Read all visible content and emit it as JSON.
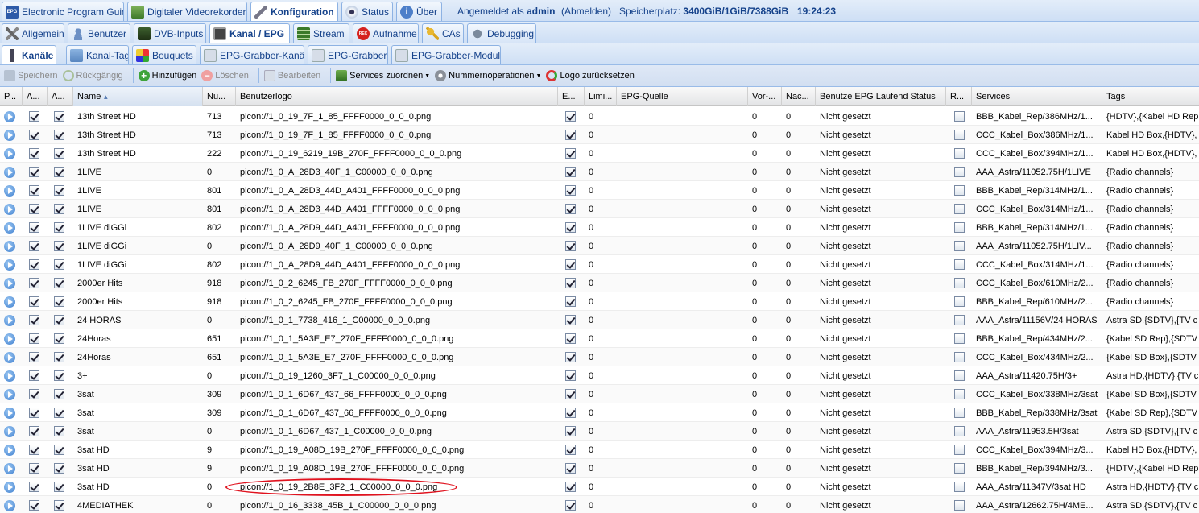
{
  "top_tabs": [
    {
      "label": "Electronic Program Guide",
      "icon": "epg-icon"
    },
    {
      "label": "Digitaler Videorekorder",
      "icon": "dvr-icon"
    },
    {
      "label": "Konfiguration",
      "icon": "wrench-icon",
      "active": true
    },
    {
      "label": "Status",
      "icon": "eye-icon"
    },
    {
      "label": "Über",
      "icon": "info-icon"
    }
  ],
  "status": {
    "logged_in_prefix": "Angemeldet als",
    "user": "admin",
    "logout": "(Abmelden)",
    "storage_prefix": "Speicherplatz:",
    "storage": "3400GiB/1GiB/7388GiB",
    "time": "19:24:23"
  },
  "config_tabs": [
    {
      "label": "Allgemein",
      "icon": "tools-icon"
    },
    {
      "label": "Benutzer",
      "icon": "user-icon"
    },
    {
      "label": "DVB-Inputs",
      "icon": "dvb-icon"
    },
    {
      "label": "Kanal / EPG",
      "icon": "tv-icon",
      "active": true
    },
    {
      "label": "Stream",
      "icon": "stream-icon"
    },
    {
      "label": "Aufnahme",
      "icon": "rec-icon"
    },
    {
      "label": "CAs",
      "icon": "key-icon"
    },
    {
      "label": "Debugging",
      "icon": "bug-icon"
    }
  ],
  "channel_tabs": [
    {
      "label": "Kanäle",
      "icon": "channel-icon",
      "active": true
    },
    {
      "label": "Kanal-Tags",
      "icon": "tag-icon"
    },
    {
      "label": "Bouquets",
      "icon": "bouquet-icon"
    },
    {
      "label": "EPG-Grabber-Kanäle",
      "icon": "grabber-channel-icon"
    },
    {
      "label": "EPG-Grabber",
      "icon": "grabber-icon"
    },
    {
      "label": "EPG-Grabber-Module",
      "icon": "grabber-module-icon"
    }
  ],
  "toolbar": {
    "save": "Speichern",
    "undo": "Rückgängig",
    "add": "Hinzufügen",
    "delete": "Löschen",
    "edit": "Bearbeiten",
    "services": "Services zuordnen",
    "numbering": "Nummernoperationen",
    "reset_logo": "Logo zurücksetzen"
  },
  "columns": [
    "P...",
    "A...",
    "A...",
    "Name",
    "Nu...",
    "Benutzerlogo",
    "E...",
    "Limi...",
    "EPG-Quelle",
    "Vor-...",
    "Nac...",
    "Benutze EPG Laufend Status",
    "R...",
    "Services",
    "Tags"
  ],
  "rows": [
    {
      "name": "13th Street HD",
      "num": "713",
      "logo": "picon://1_0_19_7F_1_85_FFFF0000_0_0_0.png",
      "limit": "0",
      "pre": "0",
      "post": "0",
      "status": "Nicht gesetzt",
      "services": "BBB_Kabel_Rep/386MHz/1...",
      "tags": "{HDTV},{Kabel HD Rep"
    },
    {
      "name": "13th Street HD",
      "num": "713",
      "logo": "picon://1_0_19_7F_1_85_FFFF0000_0_0_0.png",
      "limit": "0",
      "pre": "0",
      "post": "0",
      "status": "Nicht gesetzt",
      "services": "CCC_Kabel_Box/386MHz/1...",
      "tags": "Kabel HD Box,{HDTV},"
    },
    {
      "name": "13th Street HD",
      "num": "222",
      "logo": "picon://1_0_19_6219_19B_270F_FFFF0000_0_0_0.png",
      "limit": "0",
      "pre": "0",
      "post": "0",
      "status": "Nicht gesetzt",
      "services": "CCC_Kabel_Box/394MHz/1...",
      "tags": "Kabel HD Box,{HDTV},"
    },
    {
      "name": "1LIVE",
      "num": "0",
      "logo": "picon://1_0_A_28D3_40F_1_C00000_0_0_0.png",
      "limit": "0",
      "pre": "0",
      "post": "0",
      "status": "Nicht gesetzt",
      "services": "AAA_Astra/11052.75H/1LIVE",
      "tags": "{Radio channels}"
    },
    {
      "name": "1LIVE",
      "num": "801",
      "logo": "picon://1_0_A_28D3_44D_A401_FFFF0000_0_0_0.png",
      "limit": "0",
      "pre": "0",
      "post": "0",
      "status": "Nicht gesetzt",
      "services": "BBB_Kabel_Rep/314MHz/1...",
      "tags": "{Radio channels}"
    },
    {
      "name": "1LIVE",
      "num": "801",
      "logo": "picon://1_0_A_28D3_44D_A401_FFFF0000_0_0_0.png",
      "limit": "0",
      "pre": "0",
      "post": "0",
      "status": "Nicht gesetzt",
      "services": "CCC_Kabel_Box/314MHz/1...",
      "tags": "{Radio channels}"
    },
    {
      "name": "1LIVE diGGi",
      "num": "802",
      "logo": "picon://1_0_A_28D9_44D_A401_FFFF0000_0_0_0.png",
      "limit": "0",
      "pre": "0",
      "post": "0",
      "status": "Nicht gesetzt",
      "services": "BBB_Kabel_Rep/314MHz/1...",
      "tags": "{Radio channels}"
    },
    {
      "name": "1LIVE diGGi",
      "num": "0",
      "logo": "picon://1_0_A_28D9_40F_1_C00000_0_0_0.png",
      "limit": "0",
      "pre": "0",
      "post": "0",
      "status": "Nicht gesetzt",
      "services": "AAA_Astra/11052.75H/1LIV...",
      "tags": "{Radio channels}"
    },
    {
      "name": "1LIVE diGGi",
      "num": "802",
      "logo": "picon://1_0_A_28D9_44D_A401_FFFF0000_0_0_0.png",
      "limit": "0",
      "pre": "0",
      "post": "0",
      "status": "Nicht gesetzt",
      "services": "CCC_Kabel_Box/314MHz/1...",
      "tags": "{Radio channels}"
    },
    {
      "name": "2000er Hits",
      "num": "918",
      "logo": "picon://1_0_2_6245_FB_270F_FFFF0000_0_0_0.png",
      "limit": "0",
      "pre": "0",
      "post": "0",
      "status": "Nicht gesetzt",
      "services": "CCC_Kabel_Box/610MHz/2...",
      "tags": "{Radio channels}"
    },
    {
      "name": "2000er Hits",
      "num": "918",
      "logo": "picon://1_0_2_6245_FB_270F_FFFF0000_0_0_0.png",
      "limit": "0",
      "pre": "0",
      "post": "0",
      "status": "Nicht gesetzt",
      "services": "BBB_Kabel_Rep/610MHz/2...",
      "tags": "{Radio channels}"
    },
    {
      "name": "24 HORAS",
      "num": "0",
      "logo": "picon://1_0_1_7738_416_1_C00000_0_0_0.png",
      "limit": "0",
      "pre": "0",
      "post": "0",
      "status": "Nicht gesetzt",
      "services": "AAA_Astra/11156V/24 HORAS",
      "tags": "Astra SD,{SDTV},{TV c"
    },
    {
      "name": "24Horas",
      "num": "651",
      "logo": "picon://1_0_1_5A3E_E7_270F_FFFF0000_0_0_0.png",
      "limit": "0",
      "pre": "0",
      "post": "0",
      "status": "Nicht gesetzt",
      "services": "BBB_Kabel_Rep/434MHz/2...",
      "tags": "{Kabel SD Rep},{SDTV"
    },
    {
      "name": "24Horas",
      "num": "651",
      "logo": "picon://1_0_1_5A3E_E7_270F_FFFF0000_0_0_0.png",
      "limit": "0",
      "pre": "0",
      "post": "0",
      "status": "Nicht gesetzt",
      "services": "CCC_Kabel_Box/434MHz/2...",
      "tags": "{Kabel SD Box},{SDTV"
    },
    {
      "name": "3+",
      "num": "0",
      "logo": "picon://1_0_19_1260_3F7_1_C00000_0_0_0.png",
      "limit": "0",
      "pre": "0",
      "post": "0",
      "status": "Nicht gesetzt",
      "services": "AAA_Astra/11420.75H/3+",
      "tags": "Astra HD,{HDTV},{TV c"
    },
    {
      "name": "3sat",
      "num": "309",
      "logo": "picon://1_0_1_6D67_437_66_FFFF0000_0_0_0.png",
      "limit": "0",
      "pre": "0",
      "post": "0",
      "status": "Nicht gesetzt",
      "services": "CCC_Kabel_Box/338MHz/3sat",
      "tags": "{Kabel SD Box},{SDTV"
    },
    {
      "name": "3sat",
      "num": "309",
      "logo": "picon://1_0_1_6D67_437_66_FFFF0000_0_0_0.png",
      "limit": "0",
      "pre": "0",
      "post": "0",
      "status": "Nicht gesetzt",
      "services": "BBB_Kabel_Rep/338MHz/3sat",
      "tags": "{Kabel SD Rep},{SDTV"
    },
    {
      "name": "3sat",
      "num": "0",
      "logo": "picon://1_0_1_6D67_437_1_C00000_0_0_0.png",
      "limit": "0",
      "pre": "0",
      "post": "0",
      "status": "Nicht gesetzt",
      "services": "AAA_Astra/11953.5H/3sat",
      "tags": "Astra SD,{SDTV},{TV c"
    },
    {
      "name": "3sat HD",
      "num": "9",
      "logo": "picon://1_0_19_A08D_19B_270F_FFFF0000_0_0_0.png",
      "limit": "0",
      "pre": "0",
      "post": "0",
      "status": "Nicht gesetzt",
      "services": "CCC_Kabel_Box/394MHz/3...",
      "tags": "Kabel HD Box,{HDTV},"
    },
    {
      "name": "3sat HD",
      "num": "9",
      "logo": "picon://1_0_19_A08D_19B_270F_FFFF0000_0_0_0.png",
      "limit": "0",
      "pre": "0",
      "post": "0",
      "status": "Nicht gesetzt",
      "services": "BBB_Kabel_Rep/394MHz/3...",
      "tags": "{HDTV},{Kabel HD Rep"
    },
    {
      "name": "3sat HD",
      "num": "0",
      "logo": "picon://1_0_19_2B8E_3F2_1_C00000_0_0_0.png",
      "limit": "0",
      "pre": "0",
      "post": "0",
      "status": "Nicht gesetzt",
      "services": "AAA_Astra/11347V/3sat HD",
      "tags": "Astra HD,{HDTV},{TV c"
    },
    {
      "name": "4MEDIATHEK",
      "num": "0",
      "logo": "picon://1_0_16_3338_45B_1_C00000_0_0_0.png",
      "limit": "0",
      "pre": "0",
      "post": "0",
      "status": "Nicht gesetzt",
      "services": "AAA_Astra/12662.75H/4ME...",
      "tags": "Astra SD,{SDTV},{TV c"
    }
  ],
  "colors": {
    "tab_text": "#15428b",
    "border": "#99bbe8",
    "highlight": "#e0131f"
  }
}
